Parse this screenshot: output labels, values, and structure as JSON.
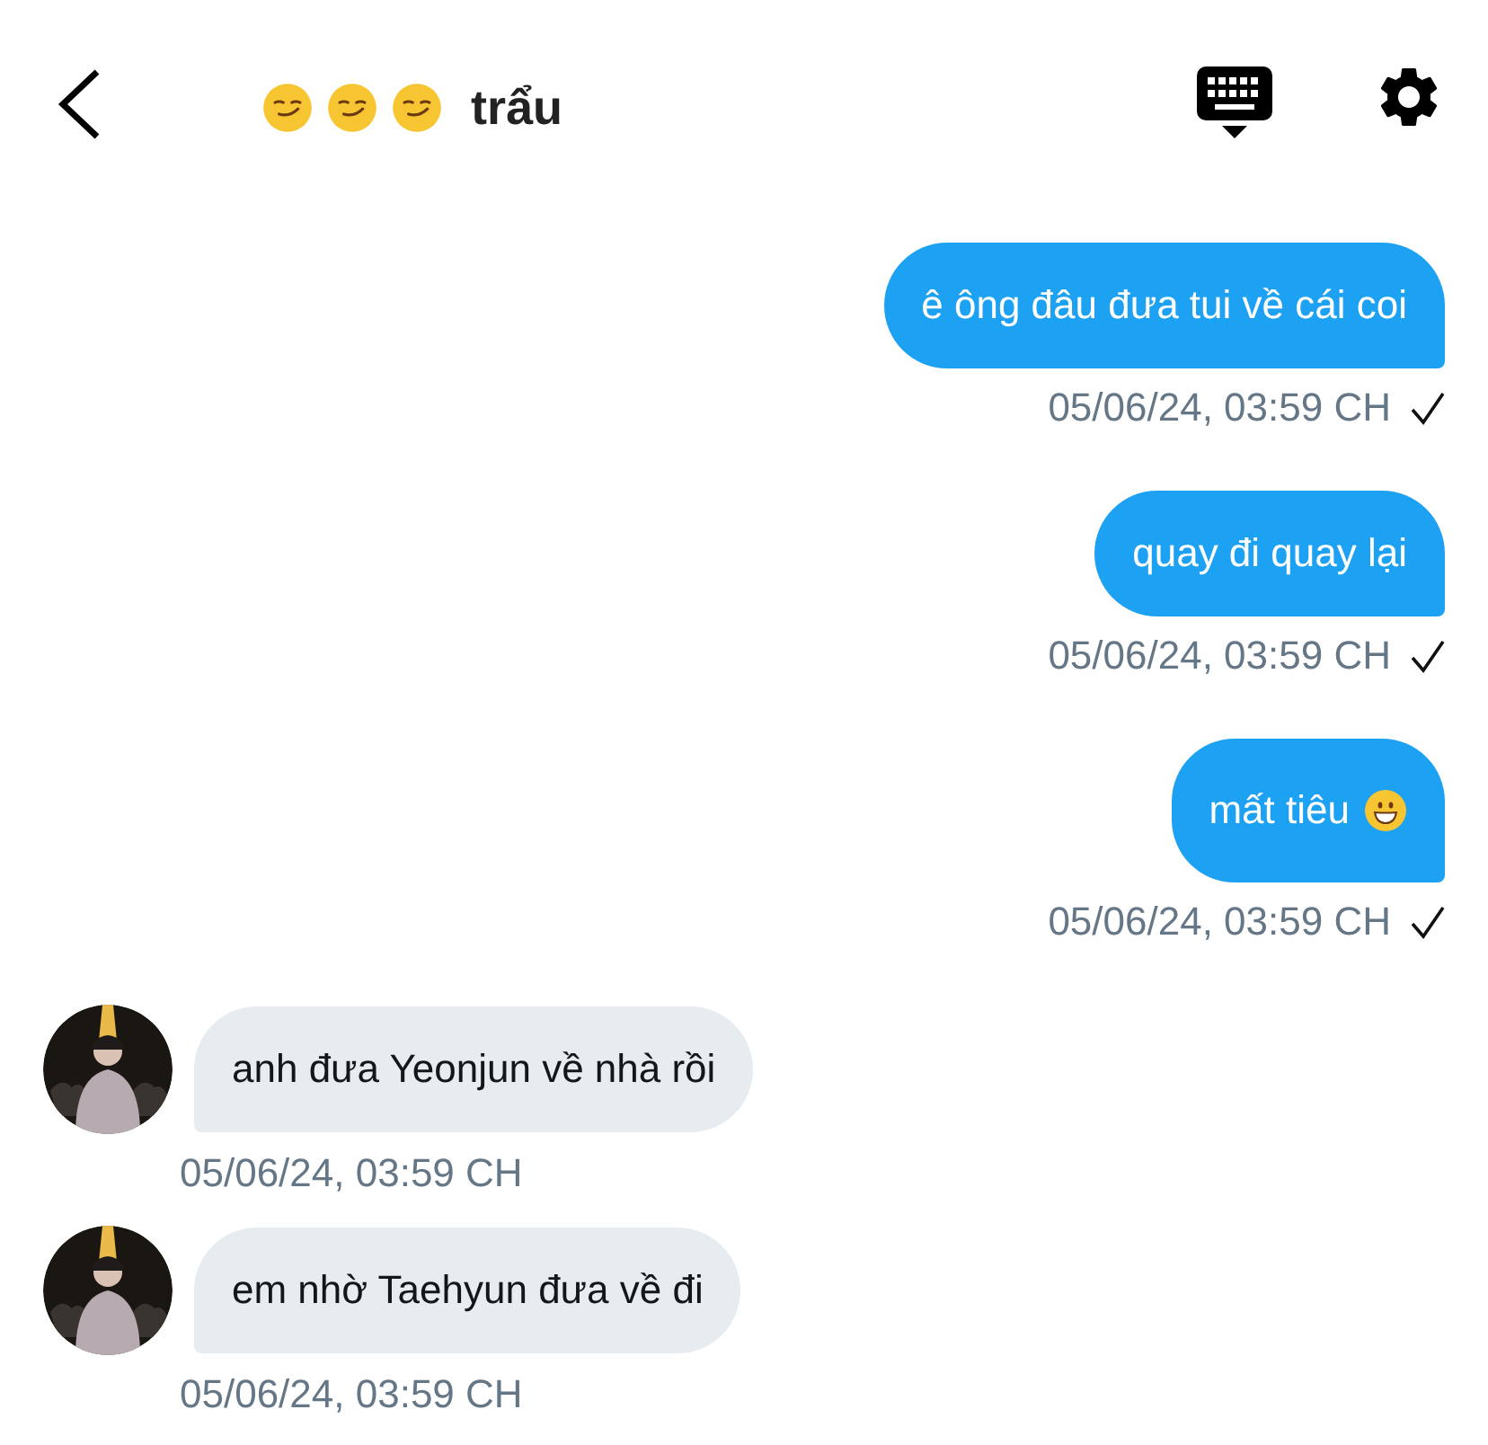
{
  "header": {
    "title_emoji": [
      {
        "kind": "smirk"
      },
      {
        "kind": "smirk"
      },
      {
        "kind": "smirk"
      }
    ],
    "title": "trẩu"
  },
  "messages": [
    {
      "kind": "sent",
      "text": "ê ông đâu đưa tui về cái coi",
      "time": "05/06/24, 03:59 CH",
      "read": true
    },
    {
      "kind": "sent",
      "text": "quay đi quay lại",
      "time": "05/06/24, 03:59 CH",
      "read": true
    },
    {
      "kind": "sent",
      "text": "mất tiêu",
      "emoji": {
        "kind": "grin"
      },
      "time": "05/06/24, 03:59 CH",
      "read": true
    },
    {
      "kind": "received",
      "text": "anh đưa Yeonjun về nhà rồi",
      "time": "05/06/24, 03:59 CH"
    },
    {
      "kind": "received",
      "text": "em nhờ Taehyun đưa về đi",
      "time": "05/06/24, 03:59 CH"
    }
  ]
}
